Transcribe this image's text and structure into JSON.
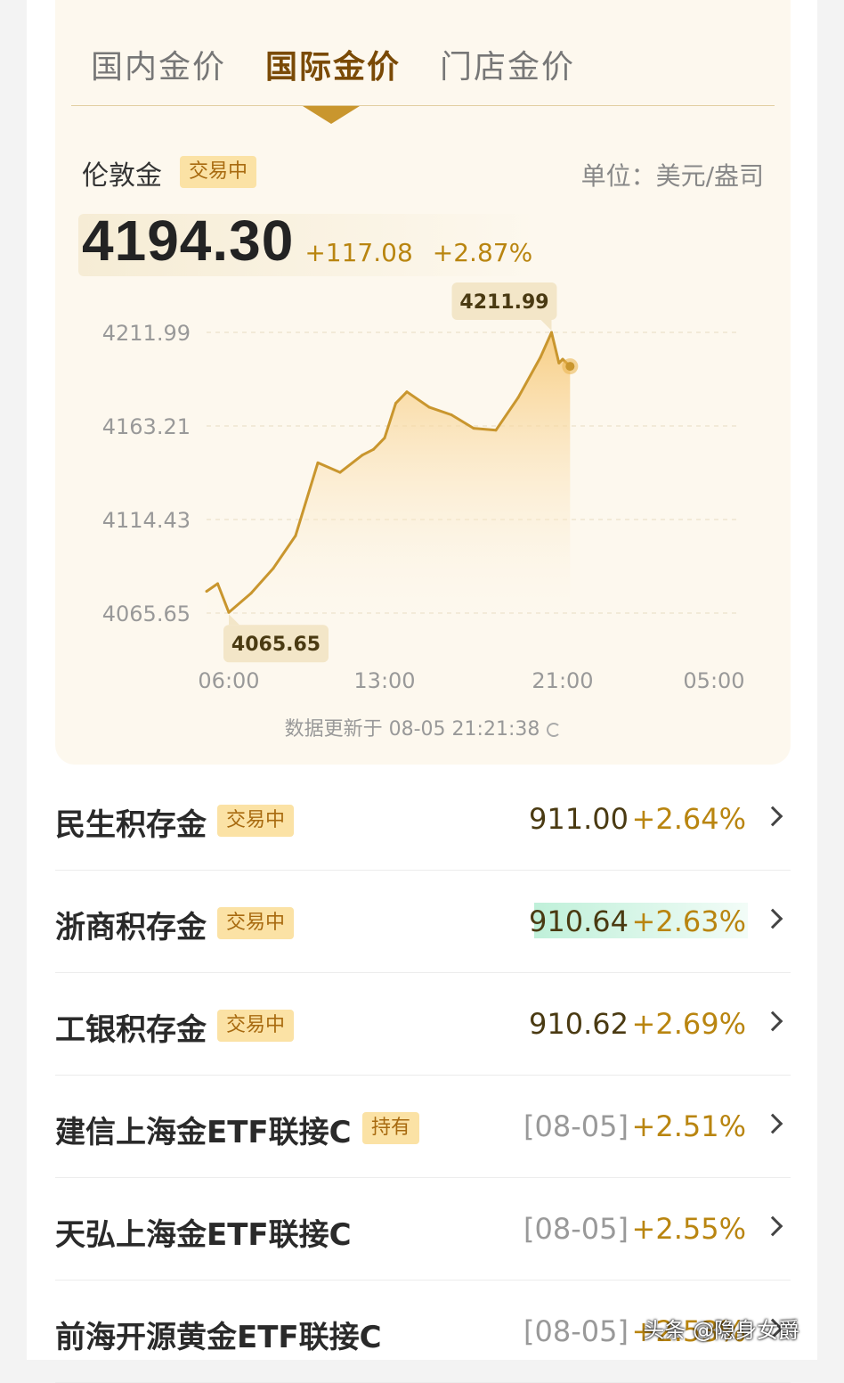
{
  "tabs": [
    {
      "label": "国内金价"
    },
    {
      "label": "国际金价"
    },
    {
      "label": "门店金价"
    }
  ],
  "asset": {
    "name": "伦敦金",
    "status": "交易中",
    "unit": "单位：美元/盎司",
    "price": "4194.30",
    "change": "+117.08",
    "change_pct": "+2.87%"
  },
  "update_text": "数据更新于 08-05 21:21:38",
  "chart_data": {
    "type": "area",
    "x_ticks": [
      "06:00",
      "13:00",
      "21:00",
      "05:00"
    ],
    "y_ticks": [
      "4211.99",
      "4163.21",
      "4114.43",
      "4065.65"
    ],
    "ylim": [
      4065.65,
      4211.99
    ],
    "max_label": "4211.99",
    "min_label": "4065.65",
    "x": [
      "05:00",
      "05:30",
      "06:00",
      "07:00",
      "08:00",
      "09:00",
      "10:00",
      "11:00",
      "12:00",
      "12:30",
      "13:00",
      "13:30",
      "14:00",
      "15:00",
      "16:00",
      "17:00",
      "18:00",
      "19:00",
      "20:00",
      "20:30",
      "20:50",
      "21:00",
      "21:20"
    ],
    "values": [
      4077,
      4081,
      4066,
      4076,
      4089,
      4106,
      4144,
      4139,
      4148,
      4151,
      4157,
      4175,
      4181,
      4173,
      4169,
      4162,
      4161,
      4178,
      4199,
      4211.99,
      4196,
      4198,
      4194.3
    ],
    "grid": true,
    "colors": {
      "line": "#c9962e",
      "fill_top": "#f7c978",
      "fill_bottom": "#fdf8ee"
    }
  },
  "list": [
    {
      "name": "民生积存金",
      "badge": "交易中",
      "value": "911.00",
      "pct": "+2.64%"
    },
    {
      "name": "浙商积存金",
      "badge": "交易中",
      "value": "910.64",
      "pct": "+2.63%"
    },
    {
      "name": "工银积存金",
      "badge": "交易中",
      "value": "910.62",
      "pct": "+2.69%"
    },
    {
      "name": "建信上海金ETF联接C",
      "badge": "持有",
      "value": "[08-05]",
      "pct": "+2.51%"
    },
    {
      "name": "天弘上海金ETF联接C",
      "value": "[08-05]",
      "pct": "+2.55%"
    },
    {
      "name": "前海开源黄金ETF联接C",
      "value": "[08-05]",
      "pct": "+2.53%"
    }
  ],
  "watermark": "头条 @隐身女爵"
}
